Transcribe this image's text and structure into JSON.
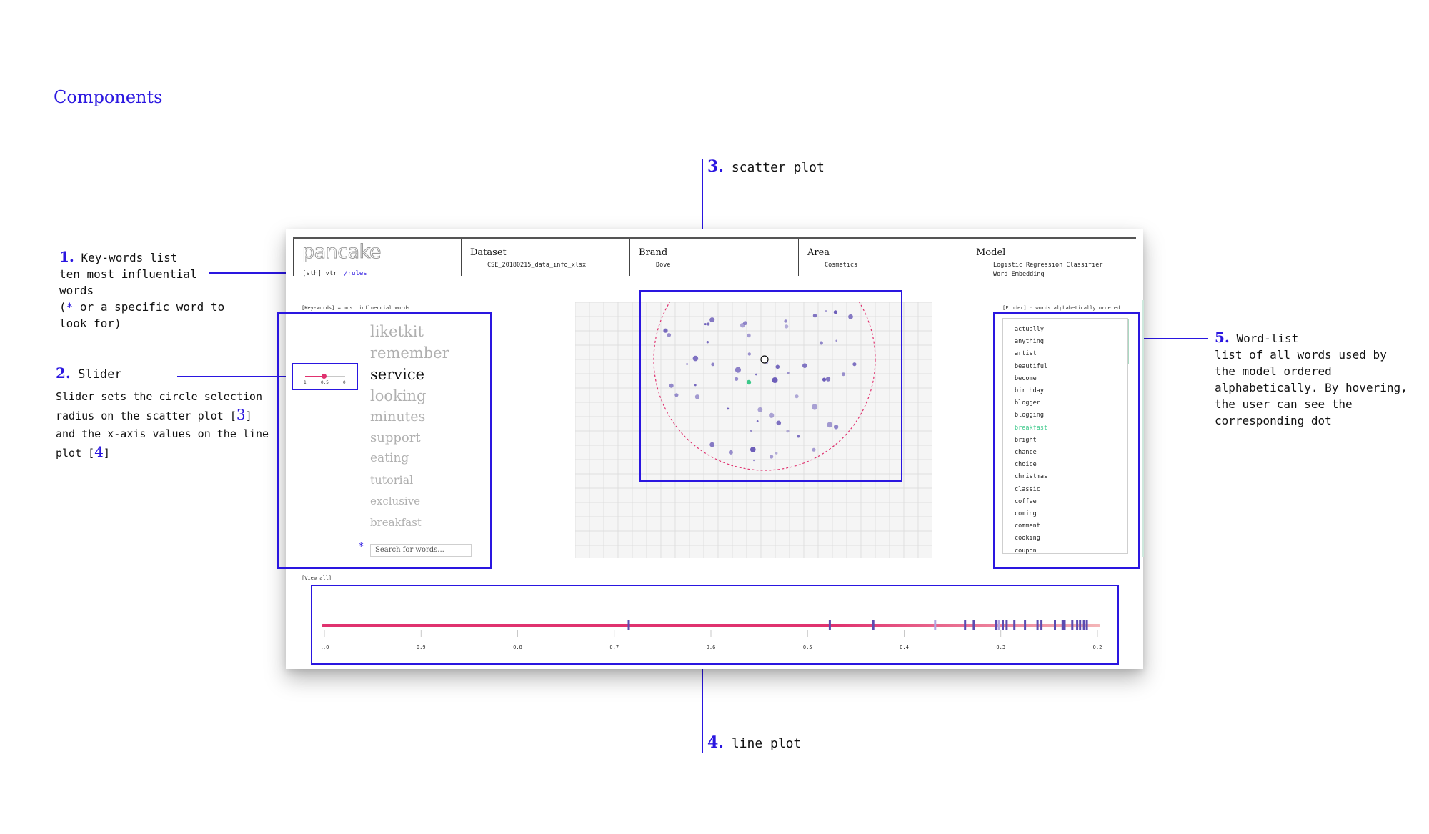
{
  "page": {
    "title": "Components"
  },
  "annotations": {
    "a1": {
      "num": "1.",
      "title": "Key-words list",
      "lines": [
        "ten most influential",
        "words"
      ],
      "star_line_a": "(",
      "star": "*",
      "star_line_b": " or a specific word to",
      "last": "look for)"
    },
    "a2": {
      "num": "2.",
      "title": "Slider",
      "l1": "Slider sets the circle selection",
      "l2a": "radius on the scatter plot [",
      "ref3": "3",
      "l2b": "]",
      "l3": "and the x-axis values on the line",
      "l4a": "plot [",
      "ref4": "4",
      "l4b": "]"
    },
    "a3": {
      "num": "3.",
      "title": "scatter plot"
    },
    "a4": {
      "num": "4.",
      "title": "line plot"
    },
    "a5": {
      "num": "5.",
      "title": "Word-list",
      "lines": [
        "list of all words used by",
        "the model ordered",
        "alphabetically. By hovering,",
        "the user can see the",
        "corresponding dot"
      ]
    }
  },
  "app": {
    "logo": "pancake",
    "links": {
      "sth": "[sth]",
      "vtr": "vtr",
      "rules": "/rules"
    },
    "header": [
      {
        "label": "Dataset",
        "values": [
          "CSE_20180215_data_info_xlsx"
        ]
      },
      {
        "label": "Brand",
        "values": [
          "Dove"
        ]
      },
      {
        "label": "Area",
        "values": [
          "Cosmetics"
        ]
      },
      {
        "label": "Model",
        "values": [
          "Logistic Regression Classifier",
          "Word Embedding"
        ]
      }
    ],
    "keywords_caption": "[Key-words] = most influencial words",
    "finder_caption": "[Finder] : words alphabetically ordered",
    "view_all": "[View all]",
    "keywords": [
      "liketkit",
      "remember",
      "service",
      "looking",
      "minutes",
      "support",
      "eating",
      "tutorial",
      "exclusive",
      "breakfast"
    ],
    "active_keyword": "service",
    "search": {
      "star": "*",
      "placeholder": "Search for words..."
    },
    "slider": {
      "min_label": "1",
      "mid_label": "0.5",
      "max_label": "0",
      "value": 0.5
    },
    "words": [
      "actually",
      "anything",
      "artist",
      "beautiful",
      "become",
      "birthday",
      "blogger",
      "blogging",
      "breakfast",
      "bright",
      "chance",
      "choice",
      "christmas",
      "classic",
      "coffee",
      "coming",
      "comment",
      "cooking",
      "coupon"
    ],
    "highlight_word": "breakfast",
    "colors": {
      "accent": "#2a16e0",
      "pink": "#e0326f",
      "dot": "#6a5bb8",
      "green": "#3cc98a"
    },
    "lineplot": {
      "ticks": [
        "1.0",
        "0.9",
        "0.8",
        "0.7",
        "0.6",
        "0.5",
        "0.4",
        "0.3",
        "0.2"
      ]
    }
  }
}
